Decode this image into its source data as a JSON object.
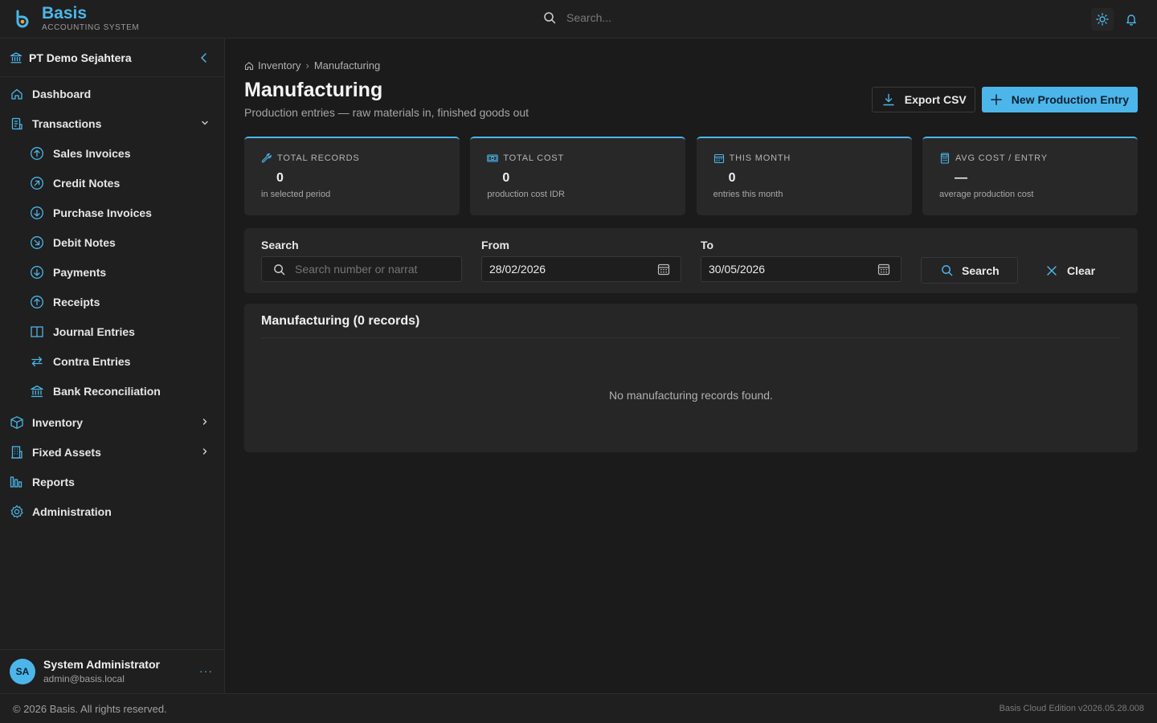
{
  "app": {
    "name": "Basis",
    "subtitle": "ACCOUNTING SYSTEM",
    "search_placeholder": "Search...",
    "accent": "#4cb6ea"
  },
  "sidebar": {
    "company": "PT Demo Sejahtera",
    "items": [
      {
        "label": "Dashboard",
        "icon": "home-icon"
      },
      {
        "label": "Transactions",
        "icon": "document-icon",
        "expanded": true
      },
      {
        "label": "Sales Invoices",
        "icon": "arrow-up-circle-icon"
      },
      {
        "label": "Credit Notes",
        "icon": "arrow-up-right-circle-icon"
      },
      {
        "label": "Purchase Invoices",
        "icon": "arrow-down-circle-icon"
      },
      {
        "label": "Debit Notes",
        "icon": "arrow-down-right-circle-icon"
      },
      {
        "label": "Payments",
        "icon": "arrow-down-circle-icon"
      },
      {
        "label": "Receipts",
        "icon": "arrow-up-circle-icon"
      },
      {
        "label": "Journal Entries",
        "icon": "book-icon"
      },
      {
        "label": "Contra Entries",
        "icon": "swap-icon"
      },
      {
        "label": "Bank Reconciliation",
        "icon": "bank-icon"
      },
      {
        "label": "Inventory",
        "icon": "box-icon"
      },
      {
        "label": "Fixed Assets",
        "icon": "building-icon"
      },
      {
        "label": "Reports",
        "icon": "bar-chart-icon"
      },
      {
        "label": "Administration",
        "icon": "gear-icon"
      }
    ],
    "user": {
      "initials": "SA",
      "name": "System Administrator",
      "email": "admin@basis.local",
      "more": "···"
    }
  },
  "main": {
    "breadcrumb": [
      "Inventory",
      "Manufacturing"
    ],
    "breadcrumb_sep": "›",
    "title": "Manufacturing",
    "subtitle": "Production entries — raw materials in, finished goods out",
    "actions": {
      "export": "Export CSV",
      "new": "New Production Entry"
    },
    "stats": [
      {
        "label": "TOTAL RECORDS",
        "value": "0",
        "foot": "in selected period",
        "icon": "wrench-icon"
      },
      {
        "label": "TOTAL COST",
        "value": "0",
        "foot": "production cost IDR",
        "icon": "money-icon"
      },
      {
        "label": "THIS MONTH",
        "value": "0",
        "foot": "entries this month",
        "icon": "calendar-icon"
      },
      {
        "label": "AVG COST / ENTRY",
        "value": "—",
        "foot": "average production cost",
        "icon": "calculator-icon"
      }
    ],
    "filter": {
      "search_label": "Search",
      "search_placeholder": "Search number or narrat",
      "from_label": "From",
      "from_value": "28/02/2026",
      "to_label": "To",
      "to_value": "30/05/2026",
      "search_button": "Search",
      "clear_button": "Clear"
    },
    "records": {
      "title": "Manufacturing (0 records)",
      "empty": "No manufacturing records found."
    }
  },
  "footer": {
    "copyright": "© 2026 Basis. All rights reserved.",
    "version": "Basis Cloud Edition v2026.05.28.008"
  }
}
